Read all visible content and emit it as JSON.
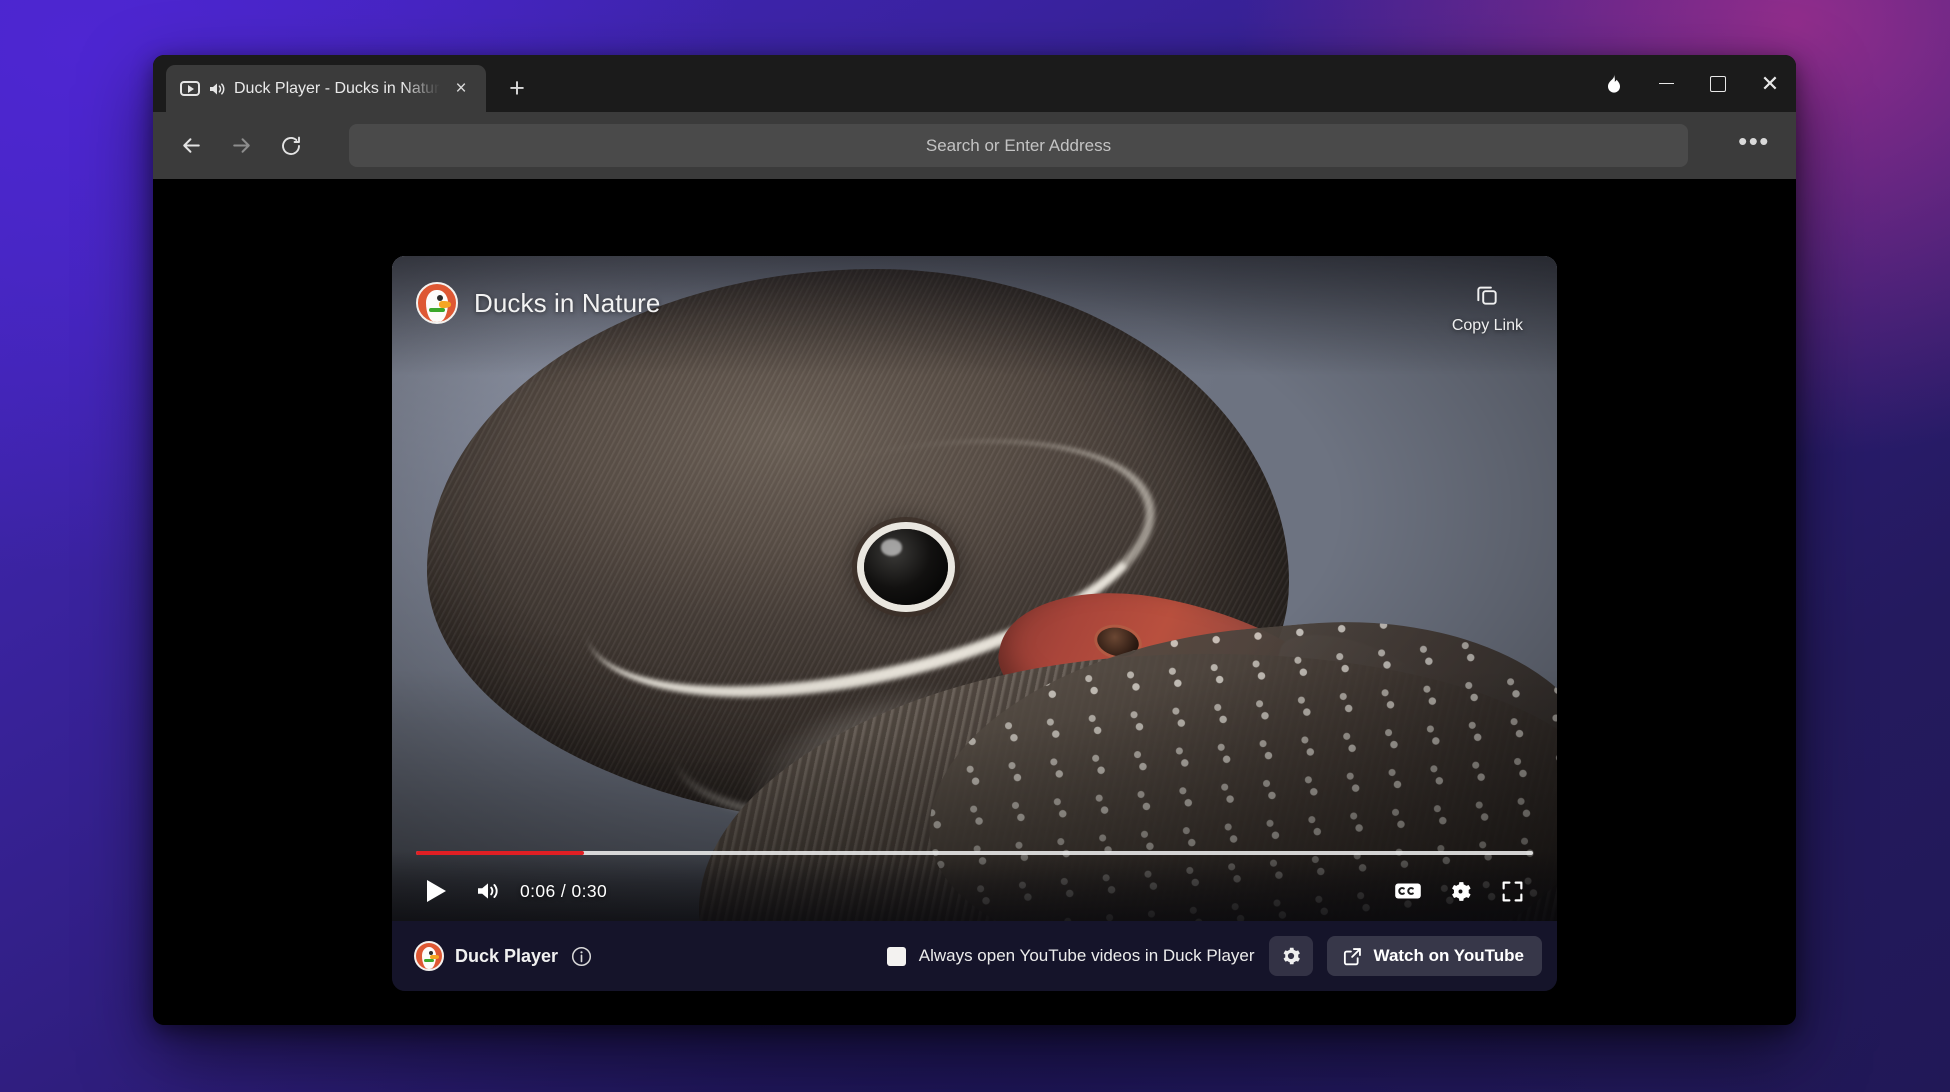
{
  "window": {
    "tab": {
      "title": "Duck Player - Ducks in Nature",
      "favicon_icon": "video-play-icon",
      "audio_icon": "speaker-playing-icon",
      "close_icon": "close-icon",
      "close_label": "×"
    },
    "new_tab_label": "+",
    "new_tab_icon": "plus-icon",
    "controls": {
      "fire_icon": "fire-button-icon",
      "minimize_icon": "minimize-icon",
      "maximize_icon": "maximize-icon",
      "close_icon": "close-icon",
      "close_label": "✕"
    }
  },
  "toolbar": {
    "back_icon": "arrow-left-icon",
    "forward_icon": "arrow-right-icon",
    "reload_icon": "reload-icon",
    "address_placeholder": "Search or Enter Address",
    "address_value": "",
    "more_label": "•••",
    "more_icon": "ellipsis-icon"
  },
  "player": {
    "video_title": "Ducks in Nature",
    "brand_icon": "duckduckgo-dax-icon",
    "copy_link_label": "Copy Link",
    "copy_link_icon": "copy-icon",
    "controls": {
      "play_icon": "play-icon",
      "volume_icon": "volume-on-icon",
      "time_display": "0:06 / 0:30",
      "current_time": "0:06",
      "duration": "0:30",
      "progress_percent": 15,
      "captions_icon": "closed-captions-icon",
      "captions_label": "CC",
      "settings_icon": "gear-icon",
      "fullscreen_icon": "fullscreen-icon",
      "progress_color": "#e01f24"
    },
    "footer": {
      "brand_label": "Duck Player",
      "brand_icon": "duckduckgo-dax-icon",
      "info_icon": "info-circle-icon",
      "always_open_label": "Always open YouTube videos in Duck Player",
      "always_open_checked": false,
      "settings_icon": "gear-icon",
      "watch_on_youtube_label": "Watch on YouTube",
      "watch_on_youtube_icon": "external-link-icon"
    }
  },
  "theme": {
    "accent_orange": "#de5833",
    "progress_red": "#e01f24",
    "window_chrome": "#3b3b3b",
    "tab_strip": "#1b1b1b",
    "page_background": "#000000",
    "footer_background": "#15142a",
    "desktop_gradient_start": "#4527c4",
    "desktop_gradient_end": "#241a5e",
    "desktop_gradient_accent": "#962e8c"
  }
}
